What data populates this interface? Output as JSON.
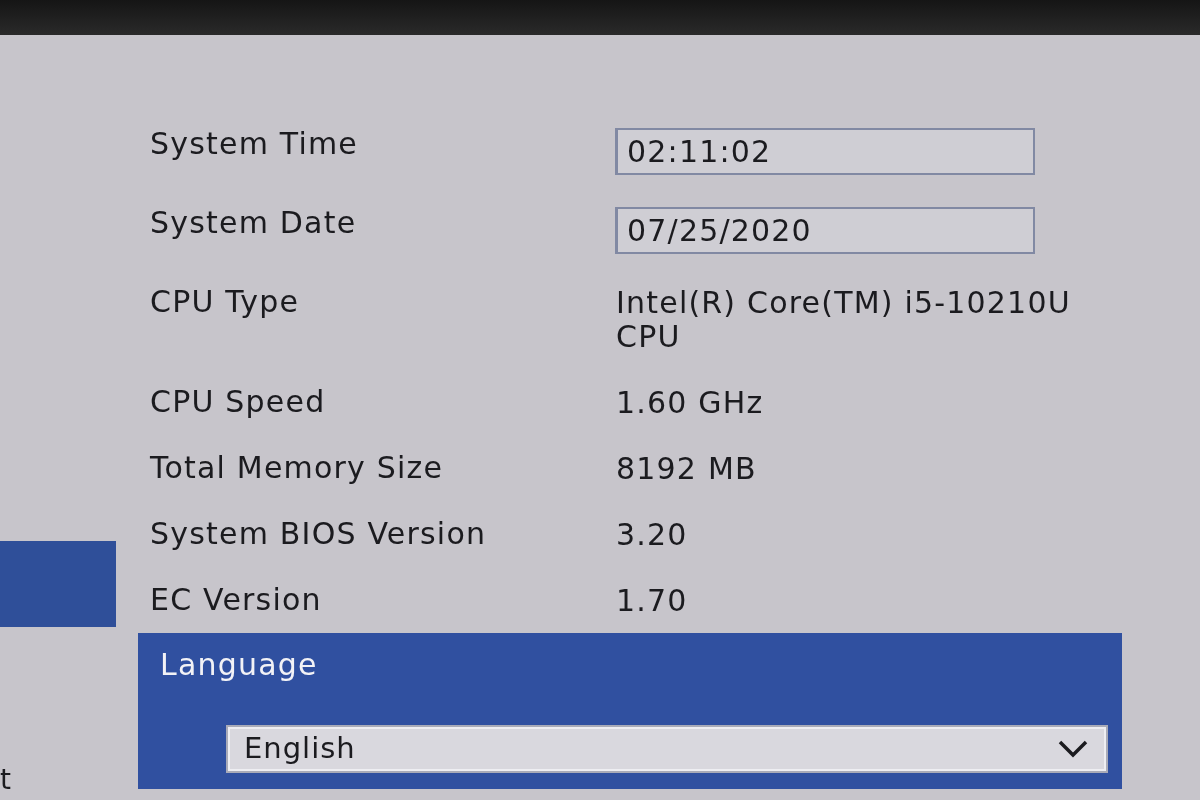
{
  "sidebar": {
    "items": [
      {
        "selected": true
      },
      {
        "label": "t",
        "selected": false
      }
    ]
  },
  "fields": [
    {
      "kind": "input",
      "label": "System Time",
      "value": "02:11:02",
      "selected": false
    },
    {
      "kind": "input",
      "label": "System Date",
      "value": "07/25/2020",
      "selected": false
    },
    {
      "kind": "text",
      "label": "CPU Type",
      "value": "Intel(R) Core(TM) i5-10210U CPU",
      "selected": false
    },
    {
      "kind": "text",
      "label": "CPU Speed",
      "value": "1.60 GHz",
      "selected": false
    },
    {
      "kind": "text",
      "label": "Total Memory Size",
      "value": "8192 MB",
      "selected": false
    },
    {
      "kind": "text",
      "label": "System BIOS Version",
      "value": "3.20",
      "selected": false
    },
    {
      "kind": "text",
      "label": "EC Version",
      "value": "1.70",
      "selected": false
    },
    {
      "kind": "dropdown",
      "label": "Language",
      "value": "English",
      "selected": true
    }
  ]
}
